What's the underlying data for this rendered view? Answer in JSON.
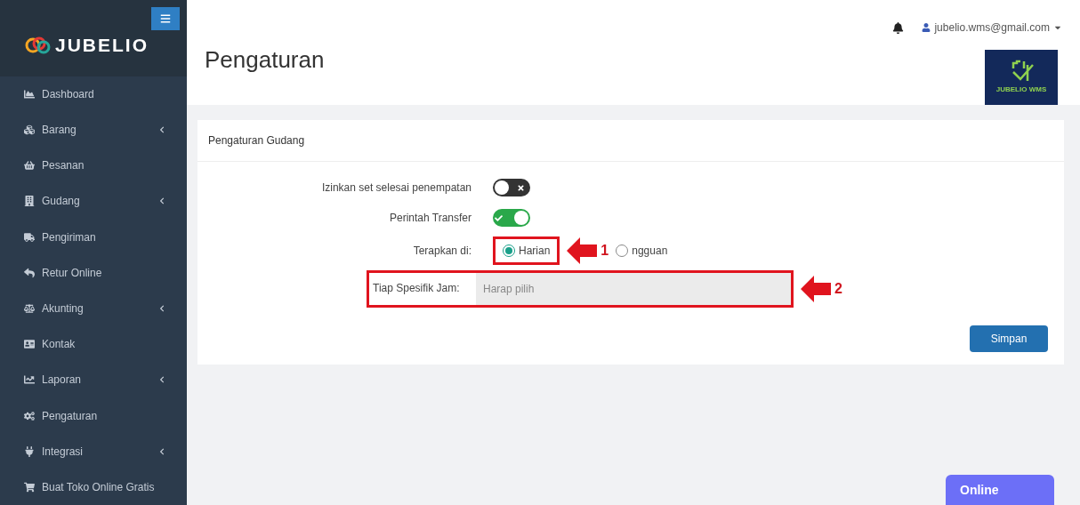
{
  "sidebar": {
    "brand": "JUBELIO",
    "items": [
      {
        "label": "Dashboard",
        "expandable": false
      },
      {
        "label": "Barang",
        "expandable": true
      },
      {
        "label": "Pesanan",
        "expandable": false
      },
      {
        "label": "Gudang",
        "expandable": true
      },
      {
        "label": "Pengiriman",
        "expandable": false
      },
      {
        "label": "Retur Online",
        "expandable": false
      },
      {
        "label": "Akunting",
        "expandable": true
      },
      {
        "label": "Kontak",
        "expandable": false
      },
      {
        "label": "Laporan",
        "expandable": true
      },
      {
        "label": "Pengaturan",
        "expandable": false
      },
      {
        "label": "Integrasi",
        "expandable": true
      },
      {
        "label": "Buat Toko Online Gratis",
        "expandable": false
      }
    ]
  },
  "header": {
    "title": "Pengaturan",
    "user": "jubelio.wms@gmail.com",
    "logo_text": "JUBELIO WMS"
  },
  "card": {
    "title": "Pengaturan Gudang",
    "toggles": [
      {
        "label": "Izinkan set selesai penempatan",
        "on": false
      },
      {
        "label": "Perintah Transfer",
        "on": true
      }
    ],
    "apply": {
      "label": "Terapkan di:",
      "options": [
        {
          "label": "Harian",
          "selected": true
        },
        {
          "label": "ngguan",
          "selected": false
        }
      ]
    },
    "hour": {
      "label": "Tiap Spesifik Jam:",
      "placeholder": "Harap pilih"
    },
    "save": "Simpan"
  },
  "annotations": [
    "1",
    "2"
  ],
  "online": "Online"
}
